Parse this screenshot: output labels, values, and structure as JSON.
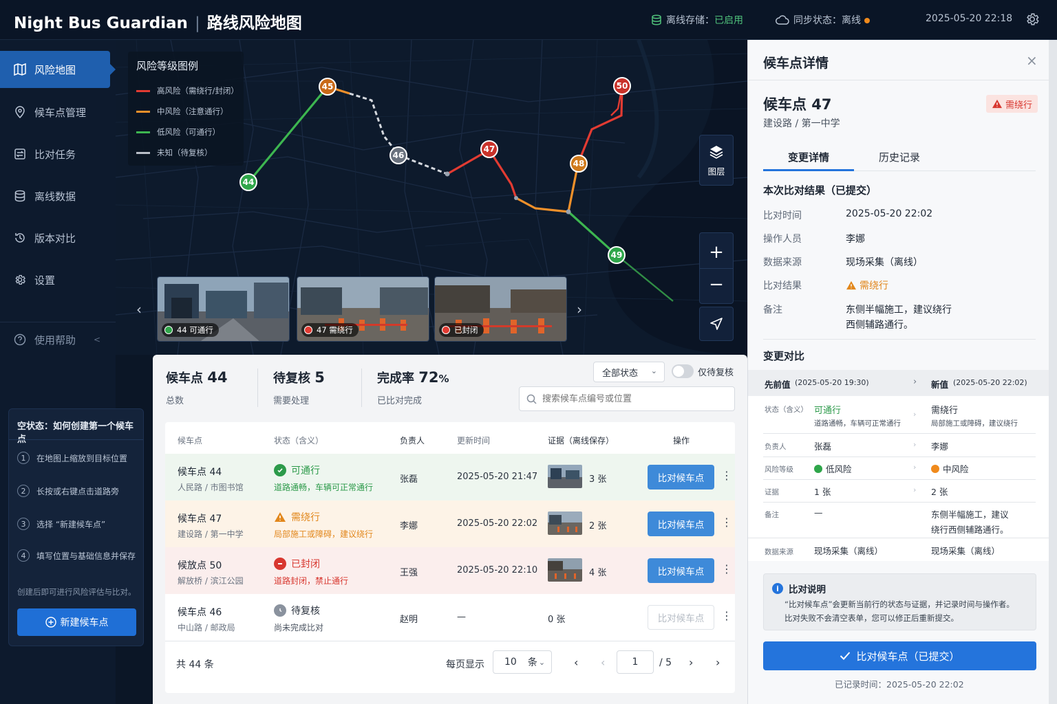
{
  "header": {
    "app_name": "Night Bus Guardian",
    "page_title": "路线风险地图",
    "storage_label": "离线存储：",
    "storage_value": "已启用",
    "sync_label": "同步状态：离线",
    "datetime": "2025-05-20 22:18"
  },
  "sidebar": {
    "items": [
      {
        "label": "风险地图",
        "icon": "map-icon"
      },
      {
        "label": "候车点管理",
        "icon": "location-pin-icon"
      },
      {
        "label": "比对任务",
        "icon": "compare-icon"
      },
      {
        "label": "离线数据",
        "icon": "database-icon"
      },
      {
        "label": "版本对比",
        "icon": "history-icon"
      },
      {
        "label": "设置",
        "icon": "gear-icon"
      }
    ],
    "help_label": "使用帮助",
    "empty_state": {
      "title": "空状态：如何创建第一个候车点",
      "steps": [
        {
          "num": "1",
          "text": "在地图上缩放到目标位置"
        },
        {
          "num": "2",
          "text": "长按或右键点击道路旁"
        },
        {
          "num": "3",
          "text": "选择 “新建候车点”"
        },
        {
          "num": "4",
          "text": "填写位置与基础信息并保存"
        }
      ],
      "note": "创建后即可进行风险评估与比对。",
      "button_label": "新建候车点"
    }
  },
  "map": {
    "legend": {
      "title": "风险等级图例",
      "items": [
        {
          "label": "高风险（需绕行/封闭）",
          "color": "#e23b32"
        },
        {
          "label": "中风险（注意通行）",
          "color": "#f0902a"
        },
        {
          "label": "低风险（可通行）",
          "color": "#3db650"
        },
        {
          "label": "未知（待复核）",
          "color": "#b8bec8"
        }
      ]
    },
    "layers_label": "图层",
    "markers": [
      {
        "id": "44",
        "color": "#2fa64a"
      },
      {
        "id": "45",
        "color": "#c96a18"
      },
      {
        "id": "46",
        "color": "#6a727e"
      },
      {
        "id": "47",
        "color": "#c9322a"
      },
      {
        "id": "48",
        "color": "#d07a1c"
      },
      {
        "id": "49",
        "color": "#2fa64a"
      },
      {
        "id": "50",
        "color": "#c9322a"
      }
    ],
    "thumbnails": [
      {
        "caption": "44 可通行",
        "dot": "#2fa64a"
      },
      {
        "caption": "47 需绕行",
        "dot": "#e23b32"
      },
      {
        "caption": "已封闭",
        "dot": "#e23b32"
      }
    ]
  },
  "stats": {
    "total_label": "候车点",
    "total_value": "44",
    "total_sub": "总数",
    "pending_label": "待复核",
    "pending_value": "5",
    "pending_sub": "需要处理",
    "rate_label": "完成率",
    "rate_value": "72",
    "rate_unit": "%",
    "rate_sub": "已比对完成"
  },
  "filters": {
    "status_select": "全部状态",
    "toggle_label": "仅待复核",
    "search_placeholder": "搜索候车点编号或位置"
  },
  "table": {
    "headers": [
      "候车点",
      "状态（含义）",
      "负责人",
      "更新时间",
      "证据（离线保存）",
      "操作"
    ],
    "rows": [
      {
        "name": "候车点 44",
        "location": "人民路 / 市图书馆",
        "status": "可通行",
        "status_desc": "道路通畅，车辆可正常通行",
        "status_color": "#2c9a4a",
        "owner": "张磊",
        "time": "2025-05-20 21:47",
        "evidence": "3 张",
        "action": "比对候车点",
        "bg": "#eef6ef"
      },
      {
        "name": "候车点 47",
        "location": "建设路 / 第一中学",
        "status": "需绕行",
        "status_desc": "局部施工或障碍，建议绕行",
        "status_color": "#e2871c",
        "owner": "李娜",
        "time": "2025-05-20 22:02",
        "evidence": "2 张",
        "action": "比对候车点",
        "bg": "#fdf3e7"
      },
      {
        "name": "候放点 50",
        "location": "解放桥 / 滨江公园",
        "status": "已封闭",
        "status_desc": "道路封闭，禁止通行",
        "status_color": "#d8372f",
        "owner": "王强",
        "time": "2025-05-20 22:10",
        "evidence": "4 张",
        "action": "比对候车点",
        "bg": "#fbeeed"
      },
      {
        "name": "候车点 46",
        "location": "中山路 / 邮政局",
        "status": "待复核",
        "status_desc": "尚未完成比对",
        "status_color": "#2c3440",
        "owner": "赵明",
        "time": "—",
        "evidence": "0 张",
        "action": "比对候车点",
        "bg": "#ffffff"
      }
    ]
  },
  "pagination": {
    "total": "共 44 条",
    "per_page_label": "每页显示",
    "per_page_value": "10",
    "per_page_unit": "条",
    "current_page": "1",
    "total_pages": "/ 5"
  },
  "detail": {
    "panel_title": "候车点详情",
    "stop_name": "候车点 47",
    "stop_location": "建设路 / 第一中学",
    "badge": "需绕行",
    "tabs": [
      "变更详情",
      "历史记录"
    ],
    "section_title": "本次比对结果（已提交）",
    "fields": [
      {
        "k": "比对时间",
        "v": "2025-05-20 22:02"
      },
      {
        "k": "操作人员",
        "v": "李娜"
      },
      {
        "k": "数据来源",
        "v": "现场采集（离线）"
      },
      {
        "k": "比对结果",
        "v": "需绕行"
      },
      {
        "k": "备注",
        "v": "东侧半幅施工，建议绕行",
        "v2": "西侧辅路通行。"
      }
    ],
    "compare_title": "变更对比",
    "before_label": "先前值",
    "before_time": "(2025-05-20 19:30)",
    "after_label": "新值",
    "after_time": "(2025-05-20 22:02)",
    "compare_rows": [
      {
        "k": "状态（含义）",
        "a": "可通行",
        "a_sub": "道路通畅，车辆可正常通行",
        "b": "需绕行",
        "b_sub": "局部施工或障碍，建议绕行"
      },
      {
        "k": "负责人",
        "a": "张磊",
        "b": "李娜"
      },
      {
        "k": "风险等级",
        "a": "低风险",
        "b": "中风险"
      },
      {
        "k": "证据",
        "a": "1 张",
        "b": "2 张"
      },
      {
        "k": "备注",
        "a": "—",
        "b": "东侧半幅施工，建议",
        "b2": "绕行西侧辅路通行。"
      },
      {
        "k": "数据来源",
        "a": "现场采集（离线）",
        "b": "现场采集（离线）"
      }
    ],
    "note_title": "比对说明",
    "note_line1": "“比对候车点”会更新当前行的状态与证据，并记录时间与操作者。",
    "note_line2": "比对失败不会清空表单，您可以修正后重新提交。",
    "submit_label": "比对候车点（已提交）",
    "recorded": "已记录时间：2025-05-20 22:02"
  }
}
